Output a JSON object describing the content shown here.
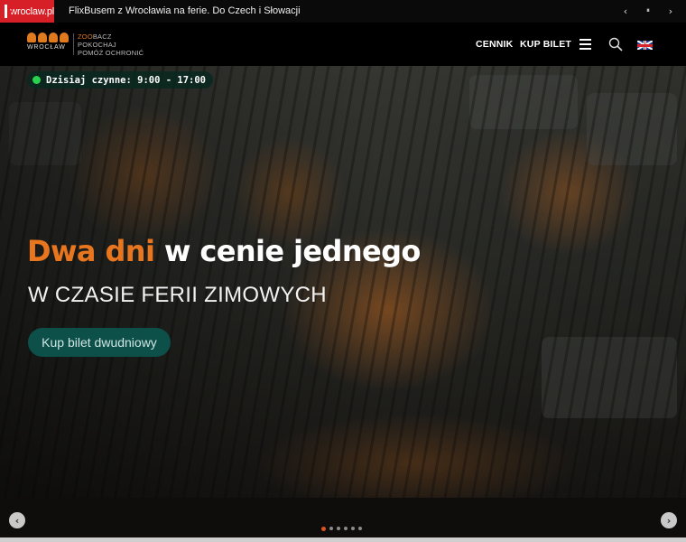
{
  "topbar": {
    "badge_text": "wroclaw.pl",
    "news_text": "FlixBusem z Wrocławia na ferie. Do Czech i Słowacji",
    "prev_icon": "‹",
    "pause_icon": "⏸",
    "next_icon": "›"
  },
  "header": {
    "logo_city": "WROCŁAW",
    "tagline_line1_prefix": "ZOO",
    "tagline_line1_rest": "BACZ",
    "tagline_line2": "POKOCHAJ",
    "tagline_line3": "POMÓŻ OCHRONIĆ",
    "nav": [
      {
        "label": "CENNIK"
      },
      {
        "label": "KUP BILET"
      }
    ],
    "icons": [
      "menu-icon",
      "search-icon",
      "uk-flag-icon"
    ]
  },
  "hero": {
    "open_hours": "Dzisiaj czynne: 9:00 - 17:00",
    "headline_accent": "Dwa dni",
    "headline_rest": " w cenie jednego",
    "subheadline": "W CZASIE FERII ZIMOWYCH",
    "cta_label": "Kup bilet dwudniowy",
    "prev_icon": "‹",
    "next_icon": "›",
    "slide_count": 6,
    "active_slide": 1
  },
  "colors": {
    "accent_orange": "#e8761e",
    "cta_teal": "#0d5049",
    "open_green": "#2ad14e",
    "wroclaw_red": "#d61f26"
  }
}
